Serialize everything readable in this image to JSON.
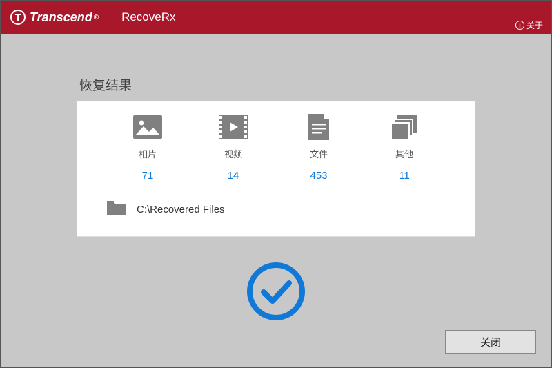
{
  "header": {
    "brand_name": "Transcend",
    "brand_mark": "T",
    "brand_reg": "®",
    "app_name": "RecoveRx",
    "about_label": "关于",
    "about_icon_char": "i"
  },
  "results": {
    "title": "恢复结果",
    "categories": [
      {
        "icon": "photo-icon",
        "label": "相片",
        "count": "71"
      },
      {
        "icon": "video-icon",
        "label": "视频",
        "count": "14"
      },
      {
        "icon": "file-icon",
        "label": "文件",
        "count": "453"
      },
      {
        "icon": "other-icon",
        "label": "其他",
        "count": "11"
      }
    ],
    "recovered_path": "C:\\Recovered Files"
  },
  "buttons": {
    "close": "关闭"
  }
}
